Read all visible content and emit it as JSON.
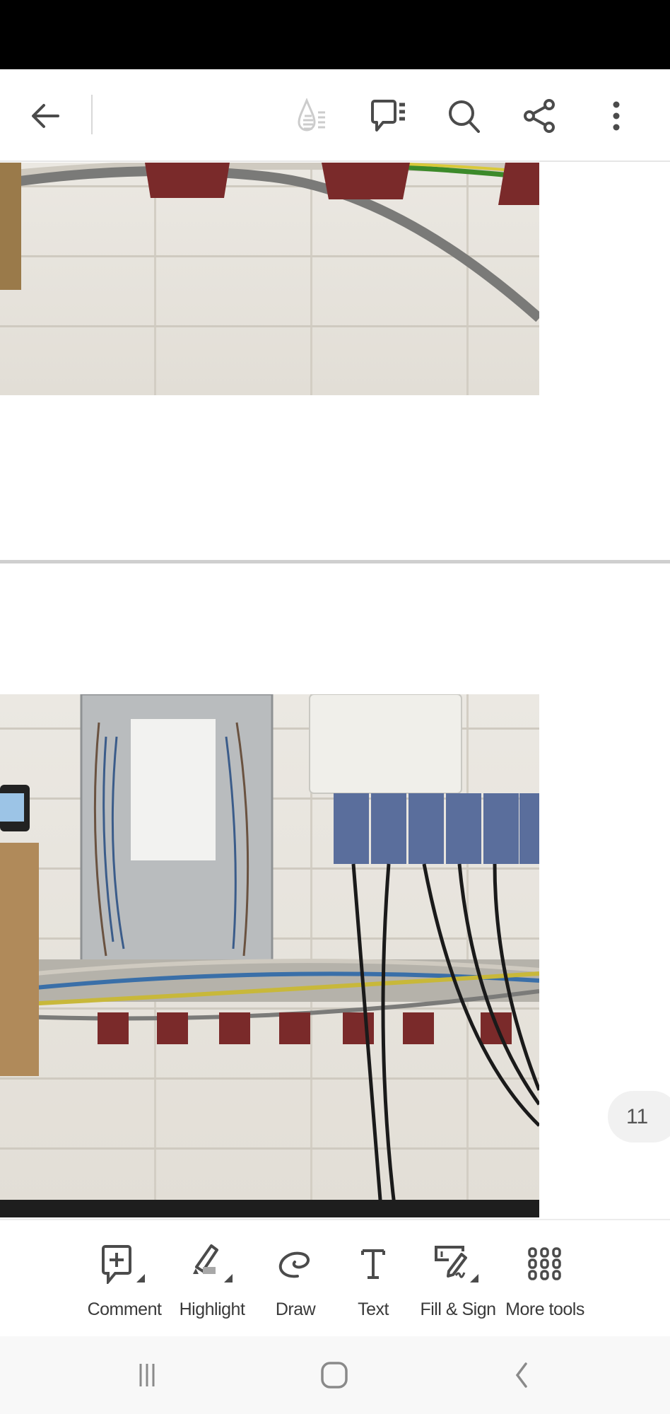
{
  "toolbar_top": {
    "icons": [
      "back-arrow-icon",
      "liquid-mode-icon",
      "comments-list-icon",
      "search-icon",
      "share-icon",
      "more-options-icon"
    ]
  },
  "document": {
    "page_number": "11"
  },
  "tools": [
    {
      "label": "Comment",
      "icon": "comment-add-icon"
    },
    {
      "label": "Highlight",
      "icon": "highlighter-icon"
    },
    {
      "label": "Draw",
      "icon": "draw-icon"
    },
    {
      "label": "Text",
      "icon": "text-icon"
    },
    {
      "label": "Fill & Sign",
      "icon": "fill-sign-icon"
    },
    {
      "label": "More tools",
      "icon": "grid-icon"
    }
  ],
  "colors": {
    "icon": "#4b4b4b",
    "disabled_icon": "#cccccc",
    "navbar": "#f8f8f8"
  }
}
